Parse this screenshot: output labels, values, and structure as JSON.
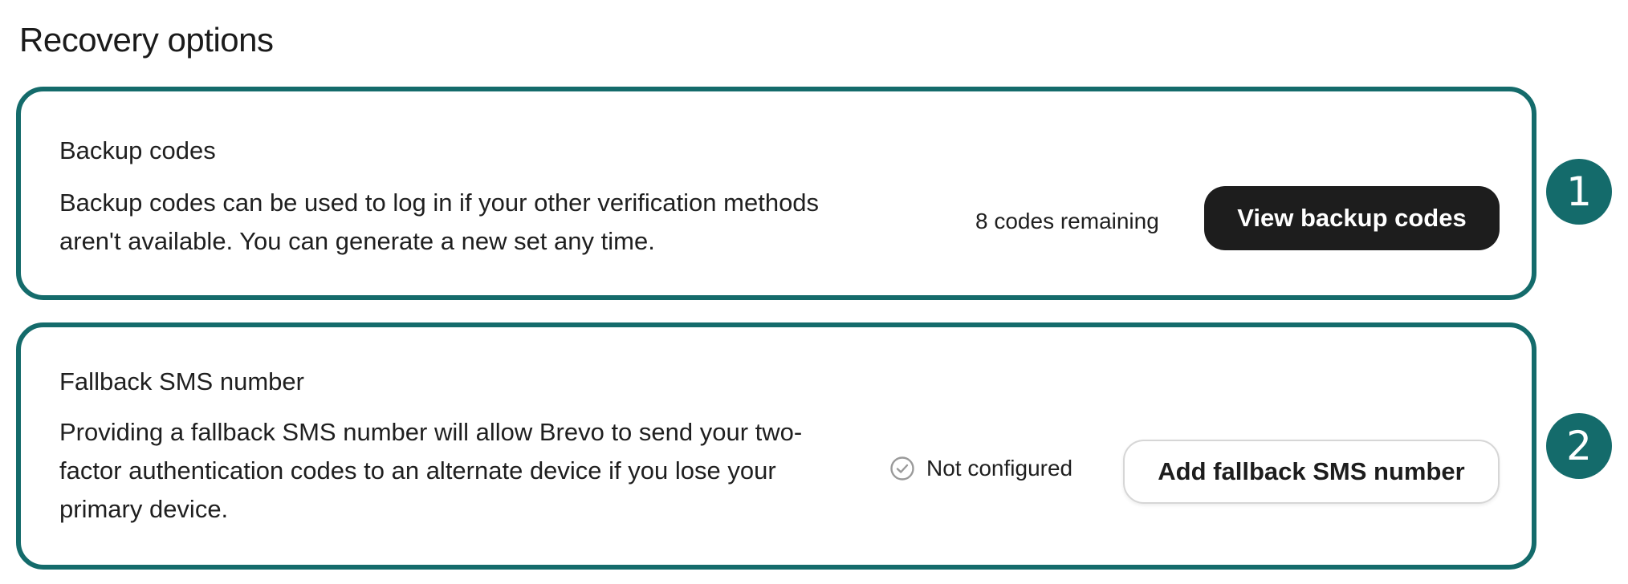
{
  "section": {
    "title": "Recovery options"
  },
  "backup_codes": {
    "title": "Backup codes",
    "description": "Backup codes can be used to log in if your other verification methods aren't available. You can generate a new set any time.",
    "status": "8 codes remaining",
    "button_label": "View backup codes"
  },
  "fallback_sms": {
    "title": "Fallback SMS number",
    "description": "Providing a fallback SMS number will allow Brevo to send your two-factor authentication codes to an alternate device if you lose your primary device.",
    "status_icon": "check-circle-icon",
    "status": "Not configured",
    "button_label": "Add fallback SMS number"
  },
  "annotations": [
    "1",
    "2"
  ],
  "colors": {
    "accent": "#146b6b",
    "primary_button": "#1d1d1d"
  }
}
